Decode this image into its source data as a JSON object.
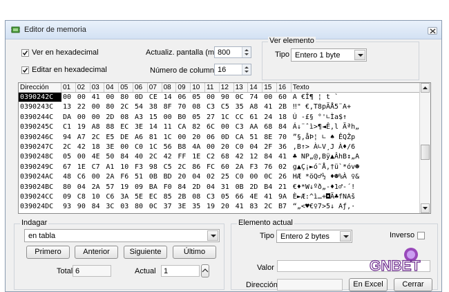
{
  "window": {
    "title": "Editor de memoria"
  },
  "options": {
    "hex_view_label": "Ver en hexadecimal",
    "hex_view_checked": true,
    "hex_edit_label": "Editar en hexadecimal",
    "hex_edit_checked": true,
    "refresh_label": "Actualiz. pantalla (ms)",
    "refresh_value": "800",
    "columns_label": "Número de columnas",
    "columns_value": "16"
  },
  "ver_elemento": {
    "title": "Ver elemento",
    "tipo_label": "Tipo",
    "tipo_value": "Entero 1 byte"
  },
  "grid": {
    "headers": [
      "Dirección",
      "01",
      "02",
      "03",
      "04",
      "05",
      "06",
      "07",
      "08",
      "09",
      "10",
      "11",
      "12",
      "13",
      "14",
      "15",
      "16",
      "Texto"
    ],
    "rows": [
      {
        "addr": "0390242C",
        "bytes": [
          "00",
          "00",
          "41",
          "00",
          "80",
          "0D",
          "CE",
          "14",
          "06",
          "05",
          "00",
          "90",
          "0C",
          "74",
          "00",
          "60"
        ],
        "text": "  A €Î¶ ¦ t `"
      },
      {
        "addr": "0390243C",
        "bytes": [
          "13",
          "22",
          "00",
          "80",
          "2C",
          "54",
          "38",
          "8F",
          "70",
          "08",
          "C3",
          "C5",
          "35",
          "A8",
          "41",
          "2B"
        ],
        "text": "‼\" €,T8pÃÅ5¨A+"
      },
      {
        "addr": "0390244C",
        "bytes": [
          "DA",
          "00",
          "00",
          "2D",
          "08",
          "A3",
          "15",
          "00",
          "B0",
          "05",
          "27",
          "1C",
          "CC",
          "61",
          "24",
          "18"
        ],
        "text": "Ú  -£§ °'∟Ìa$↑"
      },
      {
        "addr": "0390245C",
        "bytes": [
          "C1",
          "19",
          "A8",
          "88",
          "EC",
          "3E",
          "14",
          "11",
          "CA",
          "82",
          "6C",
          "00",
          "C3",
          "AA",
          "68",
          "84"
        ],
        "text": "Á↓¨ˆì>¶◄Ê‚l Ãªh„"
      },
      {
        "addr": "0390246C",
        "bytes": [
          "94",
          "A7",
          "2C",
          "E5",
          "DE",
          "A6",
          "81",
          "1C",
          "00",
          "20",
          "06",
          "0D",
          "CA",
          "51",
          "8E",
          "70"
        ],
        "text": "”§,åÞ¦ ∟ ♠ ÊQŽp"
      },
      {
        "addr": "0390247C",
        "bytes": [
          "2C",
          "42",
          "18",
          "3E",
          "00",
          "C0",
          "1C",
          "56",
          "B8",
          "4A",
          "00",
          "20",
          "C0",
          "04",
          "2F",
          "36"
        ],
        "text": ",B↑> À∟V¸J  À♦/6"
      },
      {
        "addr": "0390248C",
        "bytes": [
          "05",
          "00",
          "4E",
          "50",
          "84",
          "40",
          "2C",
          "42",
          "FF",
          "1E",
          "C2",
          "68",
          "42",
          "12",
          "84",
          "41"
        ],
        "text": "♣ NP„@,Bÿ▲ÂhB↕„A"
      },
      {
        "addr": "0390249C",
        "bytes": [
          "67",
          "1E",
          "C7",
          "A1",
          "10",
          "F3",
          "98",
          "C5",
          "2C",
          "86",
          "FC",
          "60",
          "2A",
          "F3",
          "76",
          "02"
        ],
        "text": "g▲Ç¡►ó˜Å,†ü`*óv☻"
      },
      {
        "addr": "039024AC",
        "bytes": [
          "48",
          "C6",
          "00",
          "2A",
          "F6",
          "51",
          "0B",
          "BD",
          "20",
          "04",
          "02",
          "25",
          "C0",
          "00",
          "0C",
          "26"
        ],
        "text": "HÆ *öQ♂½ ♦☻%À ♀&"
      },
      {
        "addr": "039024BC",
        "bytes": [
          "80",
          "04",
          "2A",
          "57",
          "19",
          "09",
          "BA",
          "F0",
          "84",
          "2D",
          "04",
          "31",
          "0B",
          "2D",
          "B4",
          "21"
        ],
        "text": "€♦*W↓ºð„-♦1♂-´!"
      },
      {
        "addr": "039024CC",
        "bytes": [
          "09",
          "C8",
          "10",
          "C6",
          "3A",
          "5E",
          "EC",
          "85",
          "2B",
          "08",
          "C3",
          "05",
          "66",
          "4E",
          "41",
          "9A"
        ],
        "text": "È►Æ:^ì…+◘Ã♣fNAš"
      },
      {
        "addr": "039024DC",
        "bytes": [
          "93",
          "90",
          "84",
          "3C",
          "03",
          "80",
          "0C",
          "37",
          "3E",
          "35",
          "19",
          "20",
          "41",
          "83",
          "2C",
          "B7"
        ],
        "text": "“„<♥€♀7>5↓ Aƒ,·"
      }
    ]
  },
  "indagar": {
    "title": "Indagar",
    "combo_value": "en tabla",
    "btn_first": "Primero",
    "btn_prev": "Anterior",
    "btn_next": "Siguiente",
    "btn_last": "Último",
    "total_label": "Total",
    "total_value": "6",
    "actual_label": "Actual",
    "actual_value": "1"
  },
  "elemento_actual": {
    "title": "Elemento actual",
    "tipo_label": "Tipo",
    "tipo_value": "Entero 2 bytes",
    "inverso_label": "Inverso",
    "inverso_checked": false,
    "valor_label": "Valor",
    "valor_value": "",
    "direccion_label": "Dirección",
    "direccion_value": "",
    "btn_excel": "En Excel",
    "btn_cerrar": "Cerrar"
  },
  "watermark": {
    "text": "GNBET"
  }
}
